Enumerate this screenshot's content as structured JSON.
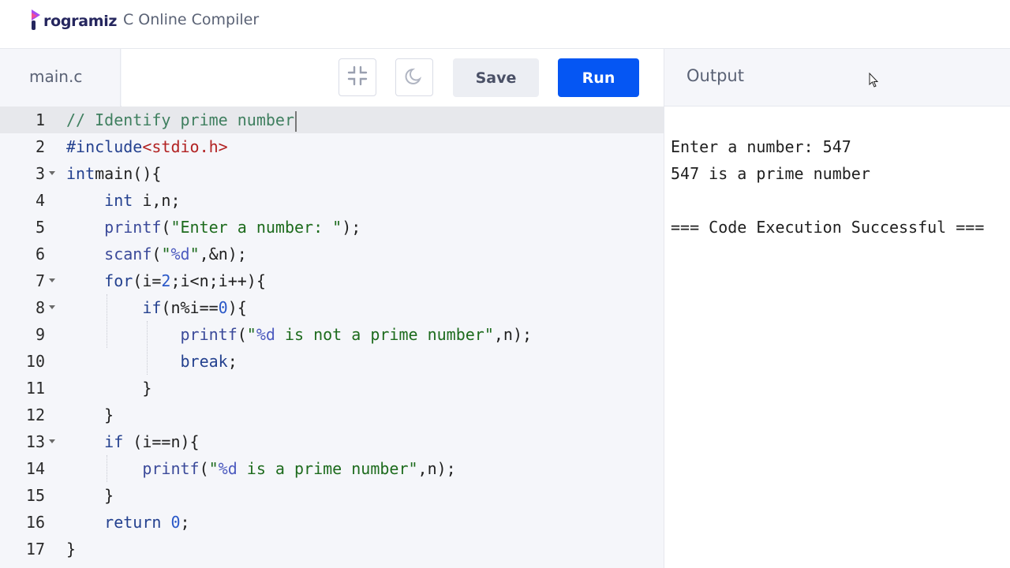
{
  "brand": {
    "logo_text": "rogramiz",
    "app_title": "C Online Compiler",
    "accent": "#0556f3"
  },
  "toolbar": {
    "file_tab": "main.c",
    "collapse_icon": "compress-icon",
    "theme_icon": "moon-icon",
    "save_label": "Save",
    "run_label": "Run"
  },
  "output": {
    "title": "Output",
    "lines": [
      "Enter a number: 547",
      "547 is a prime number",
      "",
      "=== Code Execution Successful ==="
    ]
  },
  "editor": {
    "line_numbers": [
      "1",
      "2",
      "3",
      "4",
      "5",
      "6",
      "7",
      "8",
      "9",
      "10",
      "11",
      "12",
      "13",
      "14",
      "15",
      "16",
      "17"
    ],
    "lines": [
      [
        [
          "c-com",
          "// Identify prime number"
        ]
      ],
      [
        [
          "c-pre",
          "#include"
        ],
        [
          "c-hdr",
          "<stdio.h>"
        ]
      ],
      [
        [
          "c-kw",
          "int"
        ],
        [
          "",
          "main(){"
        ]
      ],
      [
        [
          "",
          "    "
        ],
        [
          "c-kw",
          "int"
        ],
        [
          "",
          " i,n;"
        ]
      ],
      [
        [
          "",
          "    "
        ],
        [
          "c-fn",
          "printf"
        ],
        [
          "",
          "("
        ],
        [
          "c-str",
          "\"Enter a number: \""
        ],
        [
          "",
          ");"
        ]
      ],
      [
        [
          "",
          "    "
        ],
        [
          "c-fn",
          "scanf"
        ],
        [
          "",
          "("
        ],
        [
          "c-str",
          "\""
        ],
        [
          "c-fmt",
          "%d"
        ],
        [
          "c-str",
          "\""
        ],
        [
          "",
          ",&n);"
        ]
      ],
      [
        [
          "",
          "    "
        ],
        [
          "c-kw",
          "for"
        ],
        [
          "",
          "(i="
        ],
        [
          "c-num",
          "2"
        ],
        [
          "",
          ";i<n;i++){"
        ]
      ],
      [
        [
          "",
          "        "
        ],
        [
          "c-kw",
          "if"
        ],
        [
          "",
          "(n%i=="
        ],
        [
          "c-num",
          "0"
        ],
        [
          "",
          "){"
        ]
      ],
      [
        [
          "",
          "            "
        ],
        [
          "c-fn",
          "printf"
        ],
        [
          "",
          "("
        ],
        [
          "c-str",
          "\""
        ],
        [
          "c-fmt",
          "%d"
        ],
        [
          "c-str",
          " is not a prime number\""
        ],
        [
          "",
          ",n);"
        ]
      ],
      [
        [
          "",
          "            "
        ],
        [
          "c-kw",
          "break"
        ],
        [
          "",
          ";"
        ]
      ],
      [
        [
          "",
          "        }"
        ]
      ],
      [
        [
          "",
          "    }"
        ]
      ],
      [
        [
          "",
          "    "
        ],
        [
          "c-kw",
          "if"
        ],
        [
          "",
          " (i==n){"
        ]
      ],
      [
        [
          "",
          "        "
        ],
        [
          "c-fn",
          "printf"
        ],
        [
          "",
          "("
        ],
        [
          "c-str",
          "\""
        ],
        [
          "c-fmt",
          "%d"
        ],
        [
          "c-str",
          " is a prime number\""
        ],
        [
          "",
          ",n);"
        ]
      ],
      [
        [
          "",
          "    }"
        ]
      ],
      [
        [
          "",
          "    "
        ],
        [
          "c-kw",
          "return"
        ],
        [
          "",
          " "
        ],
        [
          "c-num",
          "0"
        ],
        [
          "",
          ";"
        ]
      ],
      [
        [
          "",
          "}"
        ]
      ]
    ],
    "foldable_lines": [
      3,
      7,
      8,
      13
    ]
  }
}
